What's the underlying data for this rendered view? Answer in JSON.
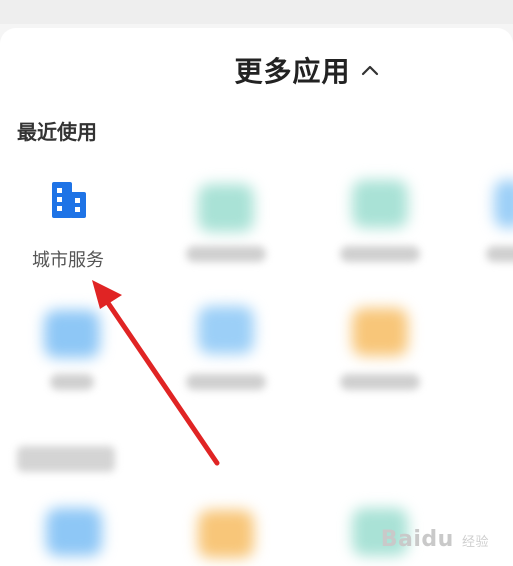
{
  "header": {
    "title": "更多应用",
    "collapse_icon": "chevron-up-icon"
  },
  "recent": {
    "section_title": "最近使用",
    "apps": [
      {
        "label": "城市服务",
        "icon": "building-icon",
        "color": "#1e73e6"
      }
    ]
  },
  "blurred_colors": {
    "teal": "#7fd4c4",
    "blue": "#6ab8f5",
    "orange": "#f7b24a"
  },
  "annotation": {
    "arrow_color": "#e02424"
  },
  "watermark": {
    "brand": "Baidu",
    "sub": "经验"
  }
}
